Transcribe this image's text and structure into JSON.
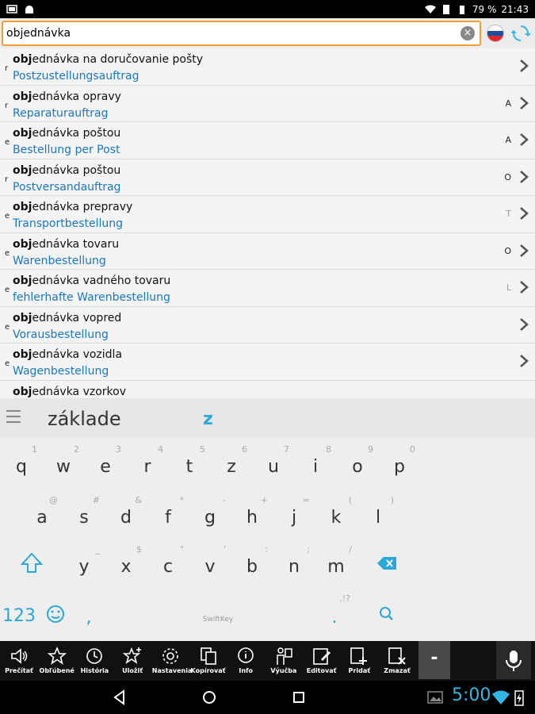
{
  "status_bar": {
    "battery": "79 %",
    "time": "21:43"
  },
  "search": {
    "query": "objednávka",
    "clear_icon": "clear-icon",
    "flag_icon": "slovak-flag-icon",
    "sync_icon": "sync-icon"
  },
  "results": [
    {
      "gender": "r",
      "head_bold": "obj",
      "head_rest": "ednávka na doručovanie pošty",
      "translation": "Postzustellungsauftrag",
      "tag": "",
      "tag_light": false
    },
    {
      "gender": "r",
      "head_bold": "obj",
      "head_rest": "ednávka opravy",
      "translation": "Reparaturauftrag",
      "tag": "A",
      "tag_light": false
    },
    {
      "gender": "e",
      "head_bold": "obj",
      "head_rest": "ednávka poštou",
      "translation": "Bestellung per Post",
      "tag": "A",
      "tag_light": false
    },
    {
      "gender": "r",
      "head_bold": "obj",
      "head_rest": "ednávka poštou",
      "translation": "Postversandauftrag",
      "tag": "O",
      "tag_light": false
    },
    {
      "gender": "e",
      "head_bold": "obj",
      "head_rest": "ednávka prepravy",
      "translation": "Transportbestellung",
      "tag": "T",
      "tag_light": true
    },
    {
      "gender": "e",
      "head_bold": "obj",
      "head_rest": "ednávka tovaru",
      "translation": "Warenbestellung",
      "tag": "O",
      "tag_light": false
    },
    {
      "gender": "e",
      "head_bold": "obj",
      "head_rest": "ednávka vadného tovaru",
      "translation": "fehlerhafte Warenbestellung",
      "tag": "L",
      "tag_light": true
    },
    {
      "gender": "e",
      "head_bold": "obj",
      "head_rest": "ednávka vopred",
      "translation": "Vorausbestellung",
      "tag": "",
      "tag_light": false
    },
    {
      "gender": "e",
      "head_bold": "obj",
      "head_rest": "ednávka vozidla",
      "translation": "Wagenbestellung",
      "tag": "",
      "tag_light": false
    },
    {
      "gender": "",
      "head_bold": "obj",
      "head_rest": "ednávka vzorkov",
      "translation": "",
      "tag": "",
      "tag_light": false
    }
  ],
  "keyboard": {
    "suggestion_1": "základe",
    "suggestion_2": "z",
    "row1": [
      {
        "k": "q",
        "s": "1"
      },
      {
        "k": "w",
        "s": "2"
      },
      {
        "k": "e",
        "s": "3"
      },
      {
        "k": "r",
        "s": "4"
      },
      {
        "k": "t",
        "s": "5"
      },
      {
        "k": "z",
        "s": "6"
      },
      {
        "k": "u",
        "s": "7"
      },
      {
        "k": "i",
        "s": "8"
      },
      {
        "k": "o",
        "s": "9"
      },
      {
        "k": "p",
        "s": "0"
      }
    ],
    "row2": [
      {
        "k": "a",
        "s": "@"
      },
      {
        "k": "s",
        "s": "#"
      },
      {
        "k": "d",
        "s": "&"
      },
      {
        "k": "f",
        "s": "*"
      },
      {
        "k": "g",
        "s": "-"
      },
      {
        "k": "h",
        "s": "+"
      },
      {
        "k": "j",
        "s": "="
      },
      {
        "k": "k",
        "s": "("
      },
      {
        "k": "l",
        "s": ")"
      }
    ],
    "row3": [
      {
        "k": "y",
        "s": "_"
      },
      {
        "k": "x",
        "s": "$"
      },
      {
        "k": "c",
        "s": "\""
      },
      {
        "k": "v",
        "s": "'"
      },
      {
        "k": "b",
        "s": ":"
      },
      {
        "k": "n",
        "s": ";"
      },
      {
        "k": "m",
        "s": "/"
      }
    ],
    "num_label": "123",
    "comma": ",",
    "period": ".",
    "period_sub": ",!?",
    "brand": "SwiftKey"
  },
  "toolbar": {
    "items": [
      {
        "label": "Prečítať",
        "icon": "speaker-icon"
      },
      {
        "label": "Obľúbené",
        "icon": "star-icon"
      },
      {
        "label": "História",
        "icon": "history-icon"
      },
      {
        "label": "Uložiť",
        "icon": "star-plus-icon"
      },
      {
        "label": "Nastavenia",
        "icon": "gear-icon"
      },
      {
        "label": "Kopírovať",
        "icon": "copy-icon"
      },
      {
        "label": "Info",
        "icon": "info-icon"
      },
      {
        "label": "Výučba",
        "icon": "teacher-icon"
      },
      {
        "label": "Editovať",
        "icon": "edit-icon"
      },
      {
        "label": "Pridať",
        "icon": "add-icon"
      },
      {
        "label": "Zmazať",
        "icon": "delete-icon"
      }
    ],
    "minus_label": "-",
    "mic_icon": "microphone-icon"
  },
  "nav": {
    "clock": "5:00"
  },
  "colors": {
    "accent": "#2aa8d8",
    "translation": "#1a77c4",
    "search_border": "#f0a030"
  }
}
